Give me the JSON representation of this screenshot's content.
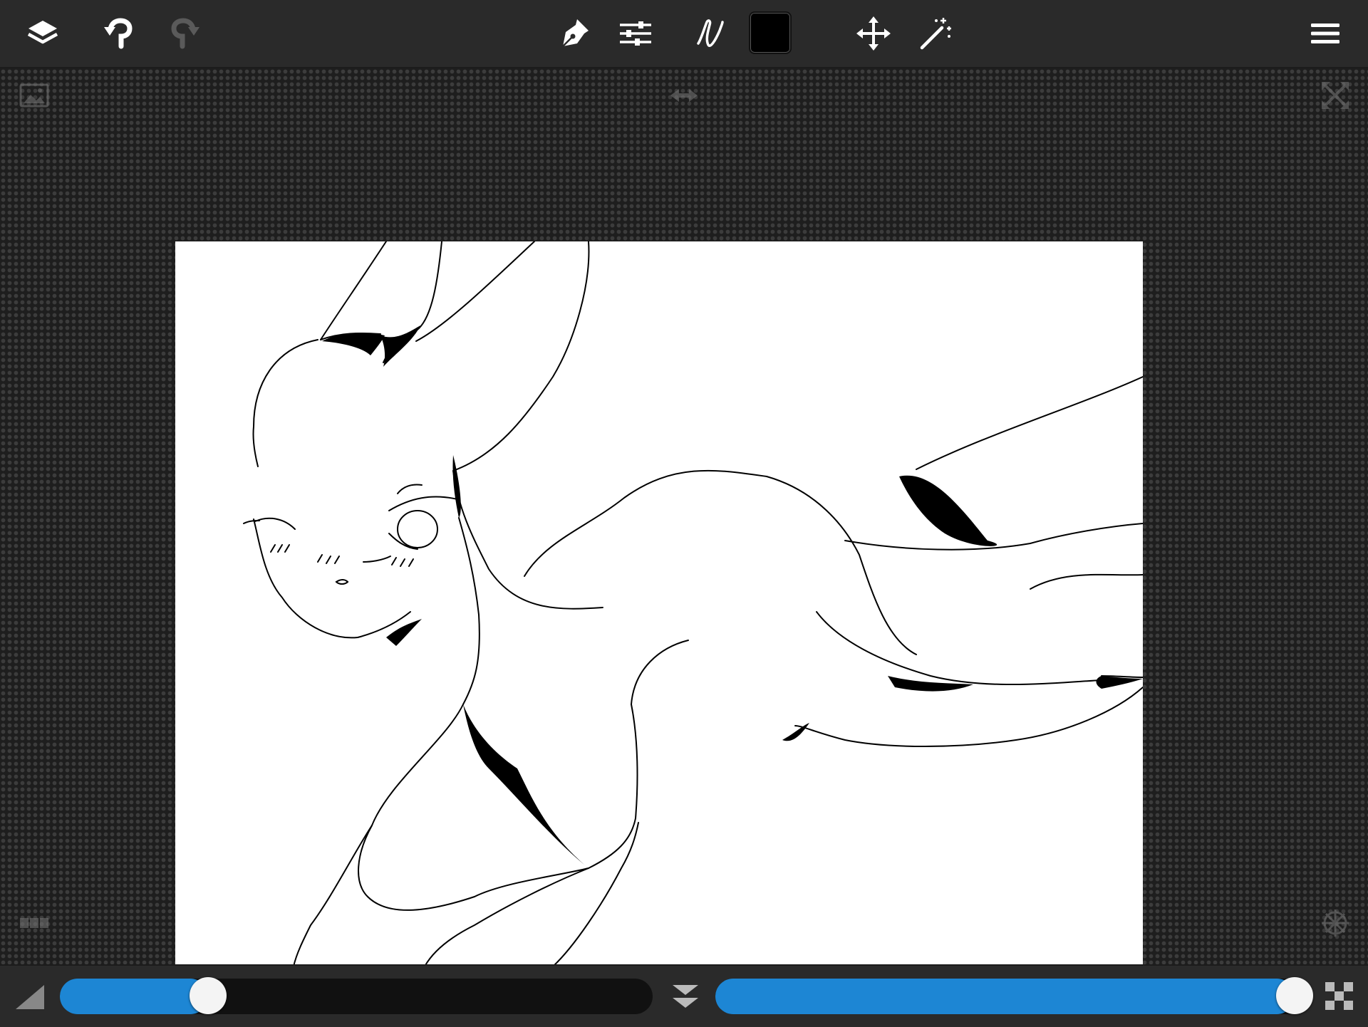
{
  "toolbar": {
    "left": [
      {
        "icon": "layers-icon"
      },
      {
        "icon": "undo-icon"
      },
      {
        "icon": "redo-icon",
        "enabled": false
      }
    ],
    "center": [
      {
        "icon": "pen-nib-icon"
      },
      {
        "icon": "adjustments-icon"
      },
      {
        "icon": "brush-stroke-icon"
      },
      {
        "icon": "color-swatch",
        "color": "#000000"
      },
      {
        "icon": "move-icon"
      },
      {
        "icon": "magic-wand-icon"
      }
    ],
    "right": [
      {
        "icon": "hamburger-menu-icon"
      }
    ]
  },
  "workspace": {
    "corner_icons": [
      "reference-image-icon",
      "flip-horizontal-icon",
      "fullscreen-icon",
      "layer-strip-icon",
      "symmetry-icon"
    ],
    "canvas_background": "#ffffff"
  },
  "bottombar": {
    "size_slider": {
      "icon": "brush-size-icon",
      "fraction": 0.25
    },
    "center_icon": "collapse-down-icon",
    "opacity_slider": {
      "icon": "opacity-checker-icon",
      "fraction": 0.97
    }
  },
  "colors": {
    "toolbar_bg": "#2a2a2a",
    "accent": "#1d86d4",
    "icon": "#ffffff",
    "icon_disabled": "#5a5a5a"
  }
}
